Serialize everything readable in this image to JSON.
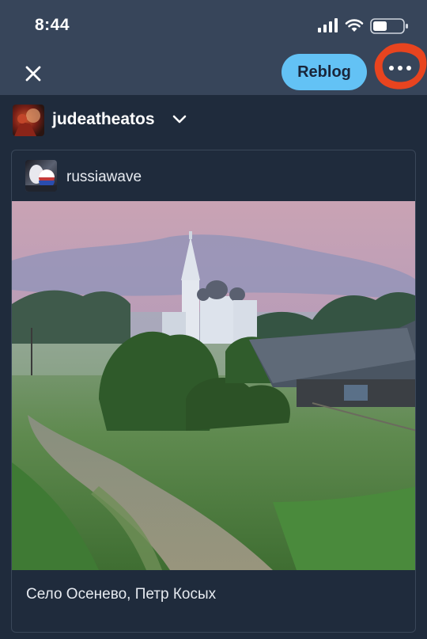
{
  "status": {
    "time": "8:44",
    "icons": [
      "signal-icon",
      "wifi-icon",
      "battery-icon"
    ]
  },
  "header": {
    "close_icon": "close-icon",
    "reblog_label": "Reblog",
    "more_icon": "more-horizontal-icon",
    "highlight_color": "#e8441f"
  },
  "poster": {
    "username": "judeatheatos",
    "menu_icon": "chevron-down-icon"
  },
  "post": {
    "original_username": "russiawave",
    "caption": "Село Осенево, Петр Косых"
  },
  "colors": {
    "accent": "#63c2f5",
    "background": "#1f2b3c",
    "header": "#37455a"
  }
}
